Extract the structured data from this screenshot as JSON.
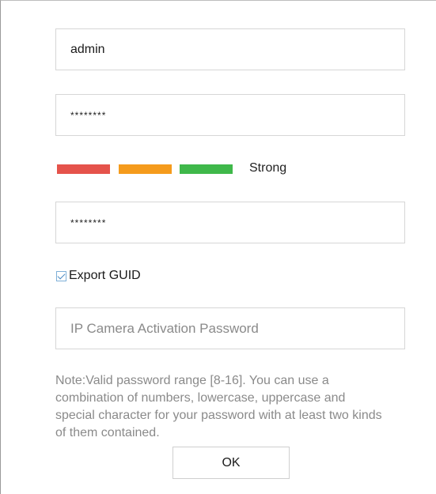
{
  "form": {
    "username_value": "admin",
    "password_value": "********",
    "confirm_password_value": "********",
    "ip_camera_password_placeholder": "IP Camera Activation Password",
    "export_guid_label": "Export GUID",
    "export_guid_checked": true
  },
  "strength": {
    "label": "Strong",
    "bars": [
      {
        "color": "#e5534b"
      },
      {
        "color": "#f59b1c"
      },
      {
        "color": "#3fb84a"
      }
    ]
  },
  "note": "Note:Valid password range [8-16]. You can use a combination of numbers, lowercase, uppercase and special character for your password with at least two kinds of them contained.",
  "actions": {
    "ok_label": "OK"
  }
}
